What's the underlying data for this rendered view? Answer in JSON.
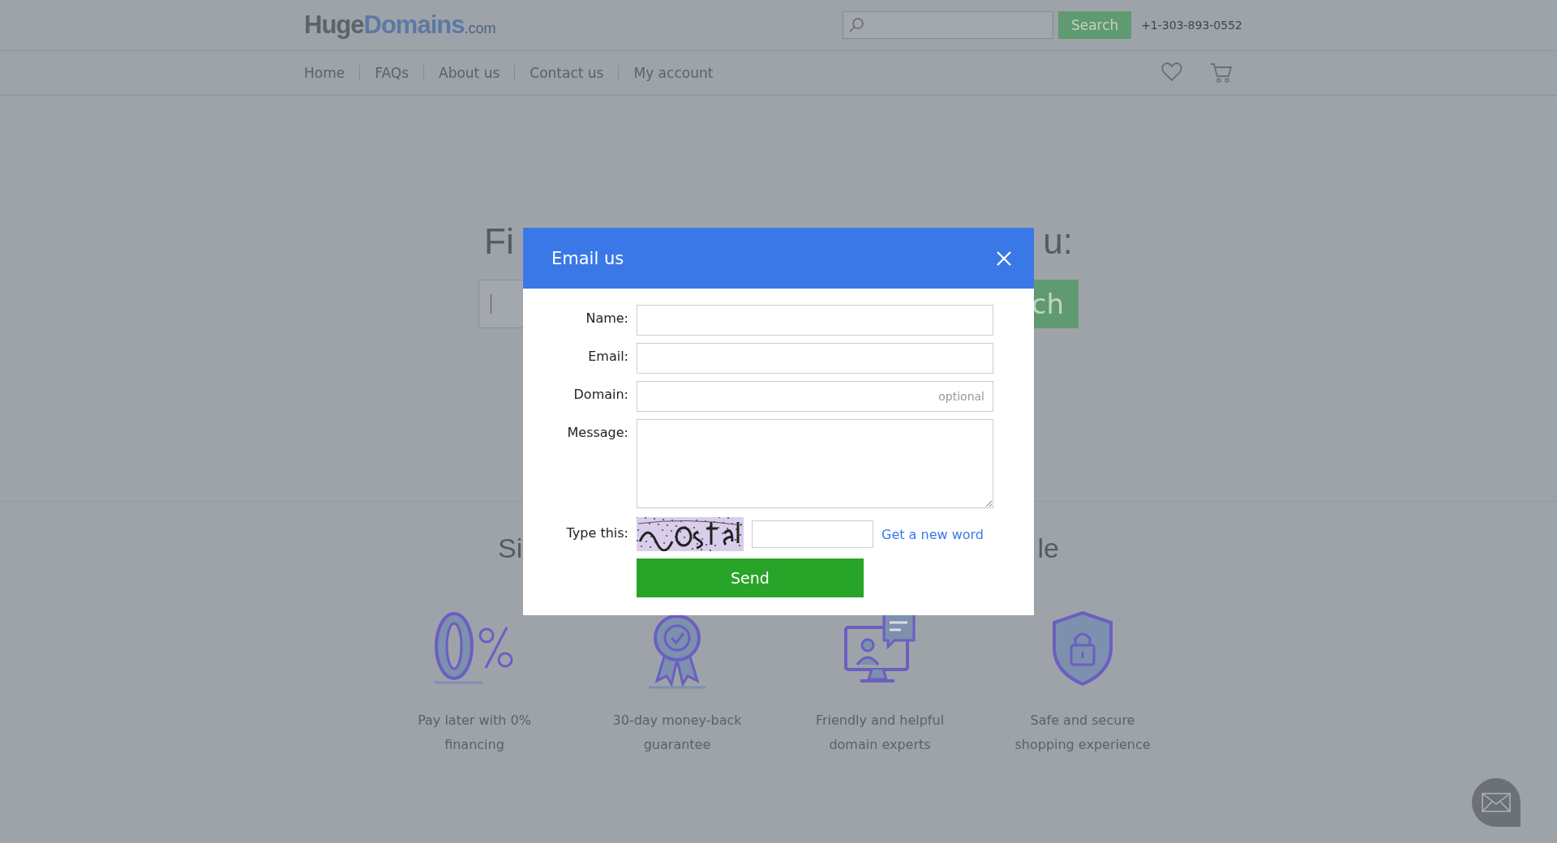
{
  "header": {
    "logo": {
      "main": "Huge",
      "accent": "Domains",
      "suffix": ".com"
    },
    "search": {
      "button": "Search"
    },
    "phone": "+1-303-893-0552"
  },
  "nav": {
    "items": [
      {
        "label": "Home"
      },
      {
        "label": "FAQs"
      },
      {
        "label": "About us"
      },
      {
        "label": "Contact us"
      },
      {
        "label": "My account"
      }
    ]
  },
  "hero": {
    "heading_left": "Fi",
    "heading_right": "u:",
    "search_button_part": "ch"
  },
  "section": {
    "heading_left": "Si",
    "heading_right": "le"
  },
  "features": [
    {
      "kind": "zero-percent",
      "lines": [
        "Pay later with 0%",
        "financing"
      ]
    },
    {
      "kind": "award",
      "lines": [
        "30-day money-back",
        "guarantee"
      ]
    },
    {
      "kind": "expert",
      "lines": [
        "Friendly and helpful",
        "domain experts"
      ]
    },
    {
      "kind": "shield",
      "lines": [
        "Safe and secure",
        "shopping experience"
      ]
    }
  ],
  "modal": {
    "title": "Email us",
    "fields": [
      {
        "kind": "input",
        "label": "Name:"
      },
      {
        "kind": "input",
        "label": "Email:"
      },
      {
        "kind": "input",
        "label": "Domain:",
        "placeholder": "optional"
      },
      {
        "kind": "textarea",
        "label": "Message:"
      }
    ],
    "captcha": {
      "label": "Type this:",
      "link": "Get a new word"
    },
    "send": "Send"
  }
}
